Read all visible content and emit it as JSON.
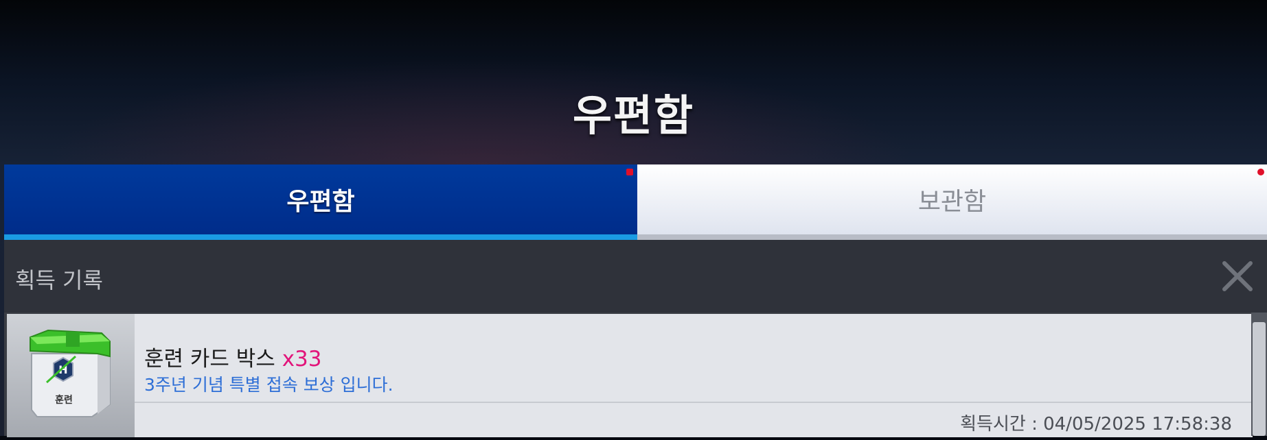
{
  "header": {
    "title": "우편함"
  },
  "tabs": [
    {
      "label": "우편함",
      "active": true,
      "has_notification": true
    },
    {
      "label": "보관함",
      "active": false,
      "has_notification": true
    }
  ],
  "history": {
    "title": "획득 기록",
    "close_icon": "close-icon"
  },
  "items": [
    {
      "icon": "training-card-box-icon",
      "icon_label": "훈련",
      "name": "훈련 카드 박스",
      "quantity": "x33",
      "description": "3주년 기념 특별 접속 보상 입니다.",
      "time": "획득시간 : 04/05/2025 17:58:38"
    }
  ],
  "colors": {
    "active_tab": "#002c8a",
    "tab_underline": "#1a9be3",
    "quantity": "#e2147a",
    "description": "#2d6ed6",
    "notification_dot": "#e0102a"
  }
}
